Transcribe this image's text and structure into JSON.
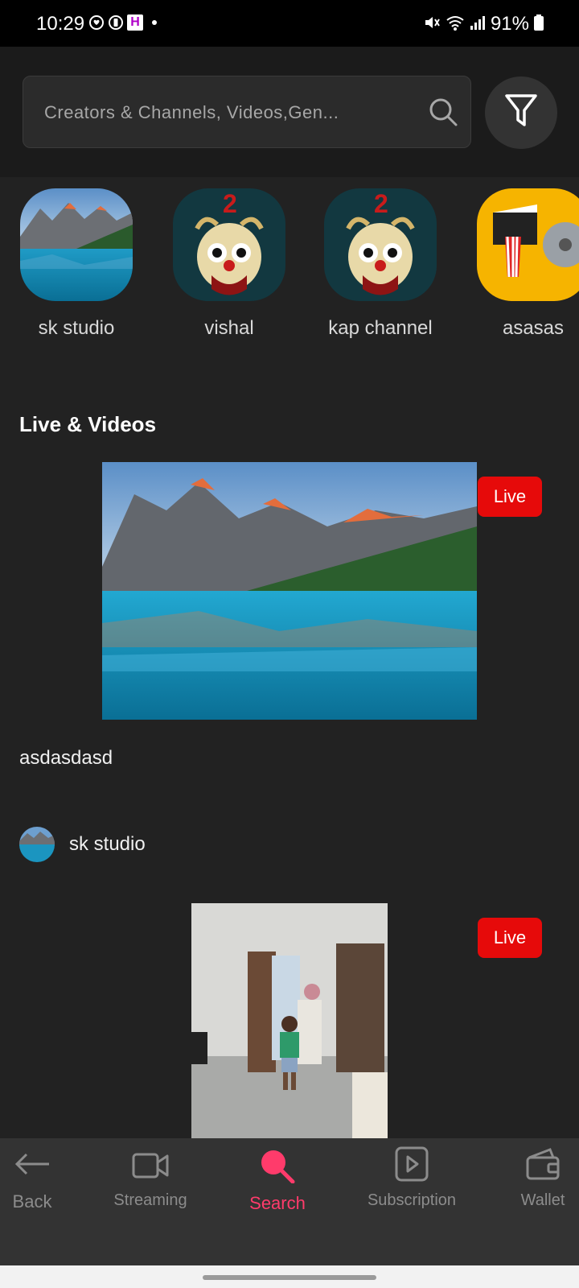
{
  "status": {
    "time": "10:29",
    "battery": "91%",
    "mini_badge": "H"
  },
  "search": {
    "placeholder": "Creators & Channels, Videos,Gen..."
  },
  "creators": [
    {
      "name": "sk studio",
      "thumb": "lake-mountains"
    },
    {
      "name": "vishal",
      "thumb": "clown-poster"
    },
    {
      "name": "kap channel",
      "thumb": "clown-poster"
    },
    {
      "name": "asasas",
      "thumb": "movie-reel"
    }
  ],
  "section": {
    "title": "Live & Videos"
  },
  "videos": [
    {
      "badge": "Live",
      "title": "asdasdasd"
    },
    {
      "badge": "Live"
    }
  ],
  "channel": {
    "name": "sk studio"
  },
  "nav": {
    "items": [
      {
        "label": "Back",
        "icon": "arrow-left-icon"
      },
      {
        "label": "Streaming",
        "icon": "video-camera-icon"
      },
      {
        "label": "Search",
        "icon": "search-icon",
        "active": true
      },
      {
        "label": "Subscription",
        "icon": "play-box-icon"
      },
      {
        "label": "Wallet",
        "icon": "wallet-icon"
      }
    ]
  },
  "colors": {
    "accent": "#ff3b6b",
    "live": "#e60a0a",
    "background": "#222222"
  }
}
